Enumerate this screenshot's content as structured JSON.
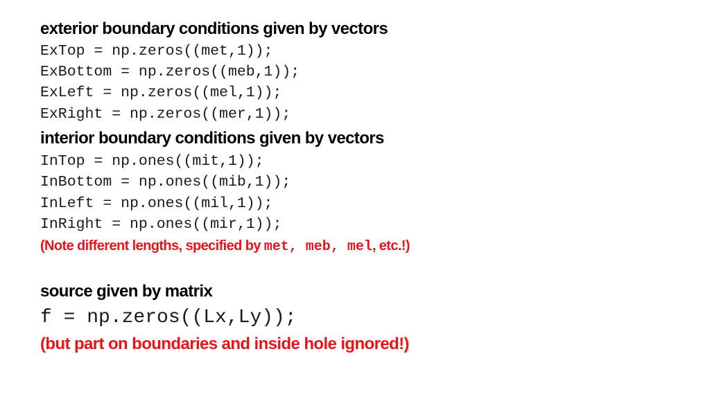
{
  "exterior": {
    "heading": "exterior boundary conditions given by vectors",
    "code_lines": [
      "ExTop = np.zeros((met,1));",
      "ExBottom = np.zeros((meb,1));",
      "ExLeft = np.zeros((mel,1));",
      "ExRight = np.zeros((mer,1));"
    ]
  },
  "interior": {
    "heading": "interior boundary conditions given by vectors",
    "code_lines": [
      "InTop = np.ones((mit,1));",
      "InBottom = np.ones((mib,1));",
      "InLeft = np.ones((mil,1));",
      "InRight = np.ones((mir,1));"
    ]
  },
  "lengths_note": {
    "prefix": "(Note different lengths, specified by ",
    "code": "met, meb, mel",
    "suffix": ", etc.!)"
  },
  "source": {
    "heading": "source given by matrix",
    "code_line": "f = np.zeros((Lx,Ly));",
    "note": "(but part on boundaries and inside hole ignored!)"
  },
  "colors": {
    "note_red": "#e8141c",
    "text": "#000000"
  }
}
